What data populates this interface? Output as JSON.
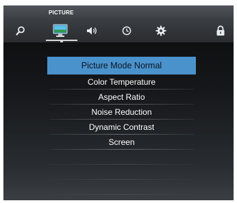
{
  "header": {
    "active_tab_title": "PICTURE"
  },
  "tabs": [
    {
      "icon": "search-icon"
    },
    {
      "icon": "monitor-icon",
      "active": true
    },
    {
      "icon": "speaker-icon"
    },
    {
      "icon": "clock-icon"
    },
    {
      "icon": "gear-icon"
    },
    {
      "icon": "lock-icon"
    }
  ],
  "menu": {
    "items": [
      {
        "label": "Picture Mode Normal",
        "selected": true
      },
      {
        "label": "Color Temperature"
      },
      {
        "label": "Aspect Ratio"
      },
      {
        "label": "Noise Reduction"
      },
      {
        "label": "Dynamic Contrast"
      },
      {
        "label": "Screen"
      }
    ]
  },
  "colors": {
    "highlight": "#4a92cc",
    "background": "#111214",
    "topbar": "#3a3d41"
  }
}
